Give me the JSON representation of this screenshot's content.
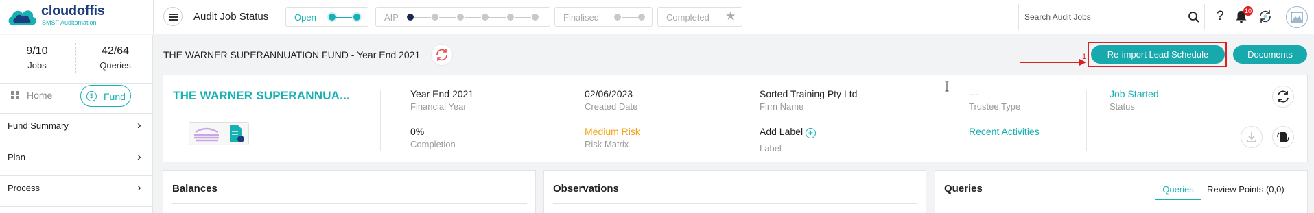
{
  "app": {
    "logo_text": "cloudoffis",
    "logo_subtext": "SMSF Auditomation",
    "page_title": "Audit Job Status"
  },
  "stages": [
    {
      "label": "Open",
      "state": "active"
    },
    {
      "label": "AIP",
      "state": "inactive"
    },
    {
      "label": "Finalised",
      "state": "inactive"
    },
    {
      "label": "Completed",
      "state": "inactive"
    }
  ],
  "search": {
    "placeholder": "Search Audit Jobs"
  },
  "notifications": {
    "count": "10"
  },
  "sidebar": {
    "jobs_value": "9/10",
    "jobs_label": "Jobs",
    "queries_value": "42/64",
    "queries_label": "Queries",
    "home_label": "Home",
    "fund_label": "Fund",
    "items": [
      {
        "label": "Fund Summary"
      },
      {
        "label": "Plan"
      },
      {
        "label": "Process"
      }
    ]
  },
  "header": {
    "fund_year": "THE WARNER SUPERANNUATION FUND - Year End 2021",
    "reimport_label": "Re-import Lead Schedule",
    "documents_label": "Documents",
    "annotation_number": "1"
  },
  "fund": {
    "name": "THE WARNER SUPERANNUA...",
    "year_end": {
      "value": "Year End 2021",
      "label": "Financial Year"
    },
    "created": {
      "value": "02/06/2023",
      "label": "Created Date"
    },
    "firm": {
      "value": "Sorted Training Pty Ltd",
      "label": "Firm Name"
    },
    "trustee": {
      "value": "---",
      "label": "Trustee Type"
    },
    "status": {
      "value": "Job Started",
      "label": "Status"
    },
    "completion": {
      "value": "0%",
      "label": "Completion"
    },
    "risk": {
      "value": "Medium Risk",
      "label": "Risk Matrix"
    },
    "add_label": {
      "value": "Add Label",
      "label": "Label"
    },
    "recent_activities": "Recent Activities"
  },
  "panels": {
    "balances_title": "Balances",
    "observations_title": "Observations",
    "queries_title": "Queries",
    "queries_tab": "Queries",
    "review_tab": "Review Points (0,0)"
  },
  "colors": {
    "accent": "#17b0b3",
    "button": "#17a9ac",
    "brand_navy": "#1a3d7c",
    "risk_medium": "#f5a31a",
    "annotation_red": "#e02020"
  }
}
